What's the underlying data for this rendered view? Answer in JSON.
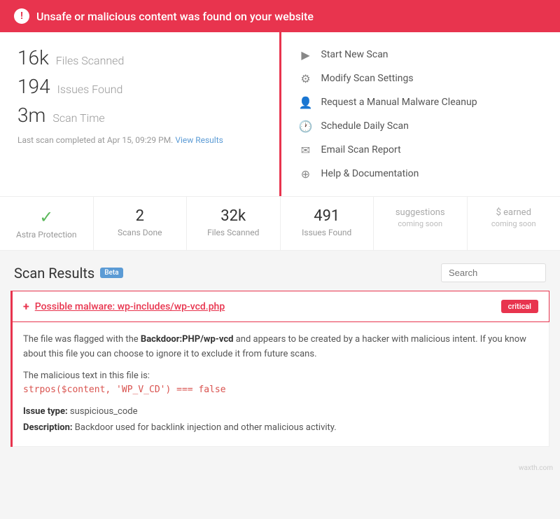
{
  "alert": {
    "text": "Unsafe or malicious content was found on your website",
    "icon": "!"
  },
  "stats": {
    "files_scanned_number": "16k",
    "files_scanned_label": "Files Scanned",
    "issues_found_number": "194",
    "issues_found_label": "Issues Found",
    "scan_time_number": "3m",
    "scan_time_label": "Scan Time",
    "last_scan": "Last scan completed at Apr 15, 09:29 PM.",
    "view_results": "View Results"
  },
  "actions": [
    {
      "icon": "▶",
      "label": "Start New Scan"
    },
    {
      "icon": "⚙",
      "label": "Modify Scan Settings"
    },
    {
      "icon": "👤",
      "label": "Request a Manual Malware Cleanup"
    },
    {
      "icon": "🕐",
      "label": "Schedule Daily Scan"
    },
    {
      "icon": "✉",
      "label": "Email Scan Report"
    },
    {
      "icon": "⊕",
      "label": "Help & Documentation"
    }
  ],
  "metrics": [
    {
      "value": "✓",
      "label": "Astra Protection",
      "type": "check"
    },
    {
      "value": "2",
      "label": "Scans Done",
      "type": "number"
    },
    {
      "value": "32k",
      "label": "Files Scanned",
      "type": "number"
    },
    {
      "value": "491",
      "label": "Issues Found",
      "type": "number"
    },
    {
      "value": "suggestions",
      "label": "coming soon",
      "type": "soon"
    },
    {
      "value": "$ earned",
      "label": "coming soon",
      "type": "soon"
    }
  ],
  "scan_results": {
    "title": "Scan Results",
    "beta": "Beta",
    "search_placeholder": "Search"
  },
  "issue": {
    "plus_icon": "+",
    "filename": "Possible malware: wp-includes/wp-vcd.php",
    "badge": "critical",
    "description_pre": "The file was flagged with the ",
    "description_bold": "Backdoor:PHP/wp-vcd",
    "description_post": " and appears to be created by a hacker with malicious intent. If you know about this file you can choose to ignore it to exclude it from future scans.",
    "malicious_label": "The malicious text in this file is:",
    "code": "strpos($content, 'WP_V_CD') === false",
    "issue_type_label": "Issue type:",
    "issue_type_value": "suspicious_code",
    "description_label": "Description:",
    "description_value": "Backdoor used for backlink injection and other malicious activity."
  },
  "watermark": "waxth.com"
}
